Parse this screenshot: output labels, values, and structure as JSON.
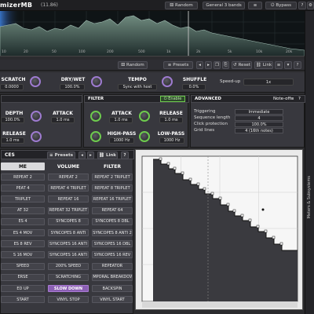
{
  "app": {
    "title": "mizerMB",
    "version": "(11.86)"
  },
  "titlebar": {
    "random": "Random",
    "preset": "General 3 bands",
    "bypass": "Bypass",
    "question": "?",
    "settings": "⚙"
  },
  "spectrum": {
    "freq_labels": [
      "10",
      "20",
      "50",
      "100",
      "200",
      "500",
      "1k",
      "2k",
      "5k",
      "10k",
      "20k"
    ]
  },
  "toolbar2": {
    "random": "Random",
    "presets": "Presets",
    "reset": "Reset",
    "link": "Link",
    "question": "?"
  },
  "knobs": {
    "scratch": {
      "label": "SCRATCH",
      "value": "0.0000"
    },
    "drywet": {
      "label": "DRY/WET",
      "value": "100.0%"
    },
    "tempo": {
      "label": "TEMPO",
      "value": "Sync with host"
    },
    "shuffle": {
      "label": "SHUFFLE",
      "value": "0.0%"
    },
    "speedup": {
      "label": "Speed-up",
      "value": "1x"
    }
  },
  "env_panel": {
    "depth": {
      "label": "DEPTH",
      "value": "100.0%"
    },
    "attack": {
      "label": "ATTACK",
      "value": "1.0 ms"
    },
    "release": {
      "label": "RELEASE",
      "value": "1.0 ms"
    }
  },
  "filter_panel": {
    "title": "FILTER",
    "enable": "Enable",
    "attack": {
      "label": "ATTACK",
      "value": "1.0 ms"
    },
    "release": {
      "label": "RELEASE",
      "value": "1.0 ms"
    },
    "highpass": {
      "label": "HIGH-PASS",
      "value": "1000 Hz"
    },
    "lowpass": {
      "label": "LOW-PASS",
      "value": "1000 Hz"
    }
  },
  "advanced": {
    "title": "ADVANCED",
    "noteoff": "Note-off",
    "rows": [
      {
        "label": "Triggering",
        "value": "Immediate"
      },
      {
        "label": "Sequence length",
        "value": "4"
      },
      {
        "label": "Click protection",
        "value": "100.0%"
      },
      {
        "label": "Grid lines",
        "value": "4 (16th notes)"
      }
    ]
  },
  "sequences": {
    "title": "CES",
    "presets": "Presets",
    "link": "Link",
    "columns": [
      "ME",
      "VOLUME",
      "FILTER"
    ],
    "rows": [
      [
        "REPEAT 2",
        "REPEAT 2",
        "REPEAT 2 TRIPLET"
      ],
      [
        "PEAT 4",
        "REPEAT 4 TRIPLET",
        "REPEAT 8 TRIPLET"
      ],
      [
        "TRIPLET",
        "REPEAT 16",
        "REPEAT 16 TRIPLET"
      ],
      [
        "AT 32",
        "REPEAT 32 TRIPLET",
        "REPEAT 64"
      ],
      [
        "ES 4",
        "SYNCOPES 8",
        "SYNCOPES 8 DBL"
      ],
      [
        "ES 4 MOV",
        "SYNCOPES 8 ANTI",
        "SYNCOPES 8 ANTI 2"
      ],
      [
        "ES 8 REV",
        "SYNCOPES 16 ANTI",
        "SYNCOPES 16 DBL"
      ],
      [
        "S 16 MOV",
        "SYNCOPES 16 ANTI",
        "SYNCOPES 16 REV"
      ],
      [
        "SPEED",
        "200% SPEED",
        "REPEATOR"
      ],
      [
        "ERSE",
        "SCRATCHING",
        "TEMPORAL BREAKDOWN"
      ],
      [
        "ED UP",
        "SLOW DOWN",
        "BACKSPIN"
      ],
      [
        "START",
        "VINYL STOP",
        "VINYL START"
      ]
    ],
    "selected": {
      "row": 10,
      "col": 1
    }
  },
  "right_strip": {
    "label": "Meters & Subsystems"
  },
  "colors": {
    "accent_purple": "#9e7bd0",
    "accent_green": "#6ecb4e",
    "bg": "#2b2b2e"
  }
}
